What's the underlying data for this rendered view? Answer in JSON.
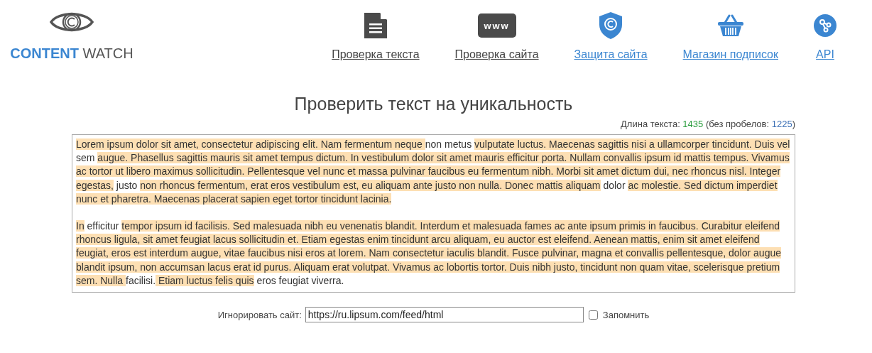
{
  "logo": {
    "brand_part_1": "CONTENT",
    "brand_part_2": "WATCH"
  },
  "nav": [
    {
      "kind": "document",
      "label": "Проверка текста",
      "visited": true
    },
    {
      "kind": "www",
      "label": "Проверка сайта",
      "visited": true,
      "icon_text": "www"
    },
    {
      "kind": "shield",
      "label": "Защита сайта",
      "visited": false
    },
    {
      "kind": "basket",
      "label": "Магазин подписок",
      "visited": false
    },
    {
      "kind": "api",
      "label": "API",
      "visited": false
    }
  ],
  "title": "Проверить текст на уникальность",
  "length": {
    "label": "Длина текста:",
    "total": "1435",
    "label_2": "(без пробелов:",
    "no_spaces": "1225",
    "close": ")"
  },
  "paragraphs": [
    [
      {
        "text": "Lorem ipsum dolor sit amet, consectetur adipiscing elit. Nam fermentum neque ",
        "highlighted": true
      },
      {
        "text": "non metus ",
        "highlighted": false
      },
      {
        "text": "vulputate luctus. Maecenas sagittis nisi a ullamcorper tincidunt. Duis vel",
        "highlighted": true
      },
      {
        "text": " sem ",
        "highlighted": false
      },
      {
        "text": "augue. Phasellus sagittis mauris sit amet tempus dictum. In vestibulum dolor sit amet mauris efficitur porta. Nullam convallis ipsum id mattis tempus. Vivamus ac tortor ut libero maximus sollicitudin. Pellentesque vel nunc et massa pulvinar faucibus eu fermentum nibh. Morbi sit amet dictum dui, nec rhoncus nisl. Integer egestas,",
        "highlighted": true
      },
      {
        "text": " justo ",
        "highlighted": false
      },
      {
        "text": "non rhoncus fermentum, erat eros vestibulum est, eu aliquam ante justo non nulla. Donec mattis aliquam",
        "highlighted": true
      },
      {
        "text": " dolor ",
        "highlighted": false
      },
      {
        "text": "ac molestie. Sed dictum imperdiet nunc et pharetra. Maecenas placerat sapien eget tortor tincidunt lacinia.",
        "highlighted": true
      }
    ],
    [
      {
        "text": "In",
        "highlighted": true
      },
      {
        "text": " efficitur ",
        "highlighted": false
      },
      {
        "text": "tempor ipsum id facilisis. Sed malesuada nibh eu venenatis blandit. Interdum et malesuada fames ac ante ipsum primis in faucibus. Curabitur eleifend rhoncus ligula, sit amet feugiat lacus sollicitudin et. Etiam egestas enim tincidunt arcu aliquam, eu auctor est eleifend. Aenean mattis, enim sit amet eleifend feugiat, eros est interdum augue, vitae faucibus nisi eros at lorem. Nam consectetur iaculis blandit. Fusce pulvinar, magna et convallis pellentesque, dolor augue blandit ipsum, non accumsan lacus erat id purus. Aliquam erat volutpat. Vivamus ac lobortis tortor. Duis nibh justo, tincidunt non quam vitae, scelerisque pretium sem. Nulla ",
        "highlighted": true
      },
      {
        "text": "facilisi.",
        "highlighted": false
      },
      {
        "text": " Etiam luctus felis quis",
        "highlighted": true
      },
      {
        "text": " eros feugiat viverra.",
        "highlighted": false
      }
    ]
  ],
  "ignore": {
    "label": "Игнорировать сайт:",
    "value": "https://ru.lipsum.com/feed/html",
    "remember_label": "Запомнить",
    "remember_checked": false
  }
}
